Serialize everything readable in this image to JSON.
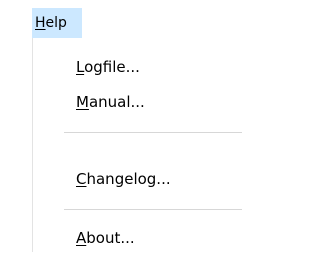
{
  "menubar": {
    "help": {
      "accel": "H",
      "rest": "elp",
      "label": "Help"
    }
  },
  "menu": {
    "items": [
      {
        "accel": "L",
        "rest": "ogfile...",
        "label": "Logfile..."
      },
      {
        "accel": "M",
        "rest": "anual...",
        "label": "Manual..."
      },
      {
        "accel": "C",
        "rest": "hangelog...",
        "label": "Changelog..."
      },
      {
        "accel": "A",
        "rest": "bout...",
        "label": "About..."
      }
    ]
  },
  "colors": {
    "menubar_highlight": "#cce8ff",
    "menu_background": "#ffffff",
    "separator": "#d7d7d7"
  }
}
